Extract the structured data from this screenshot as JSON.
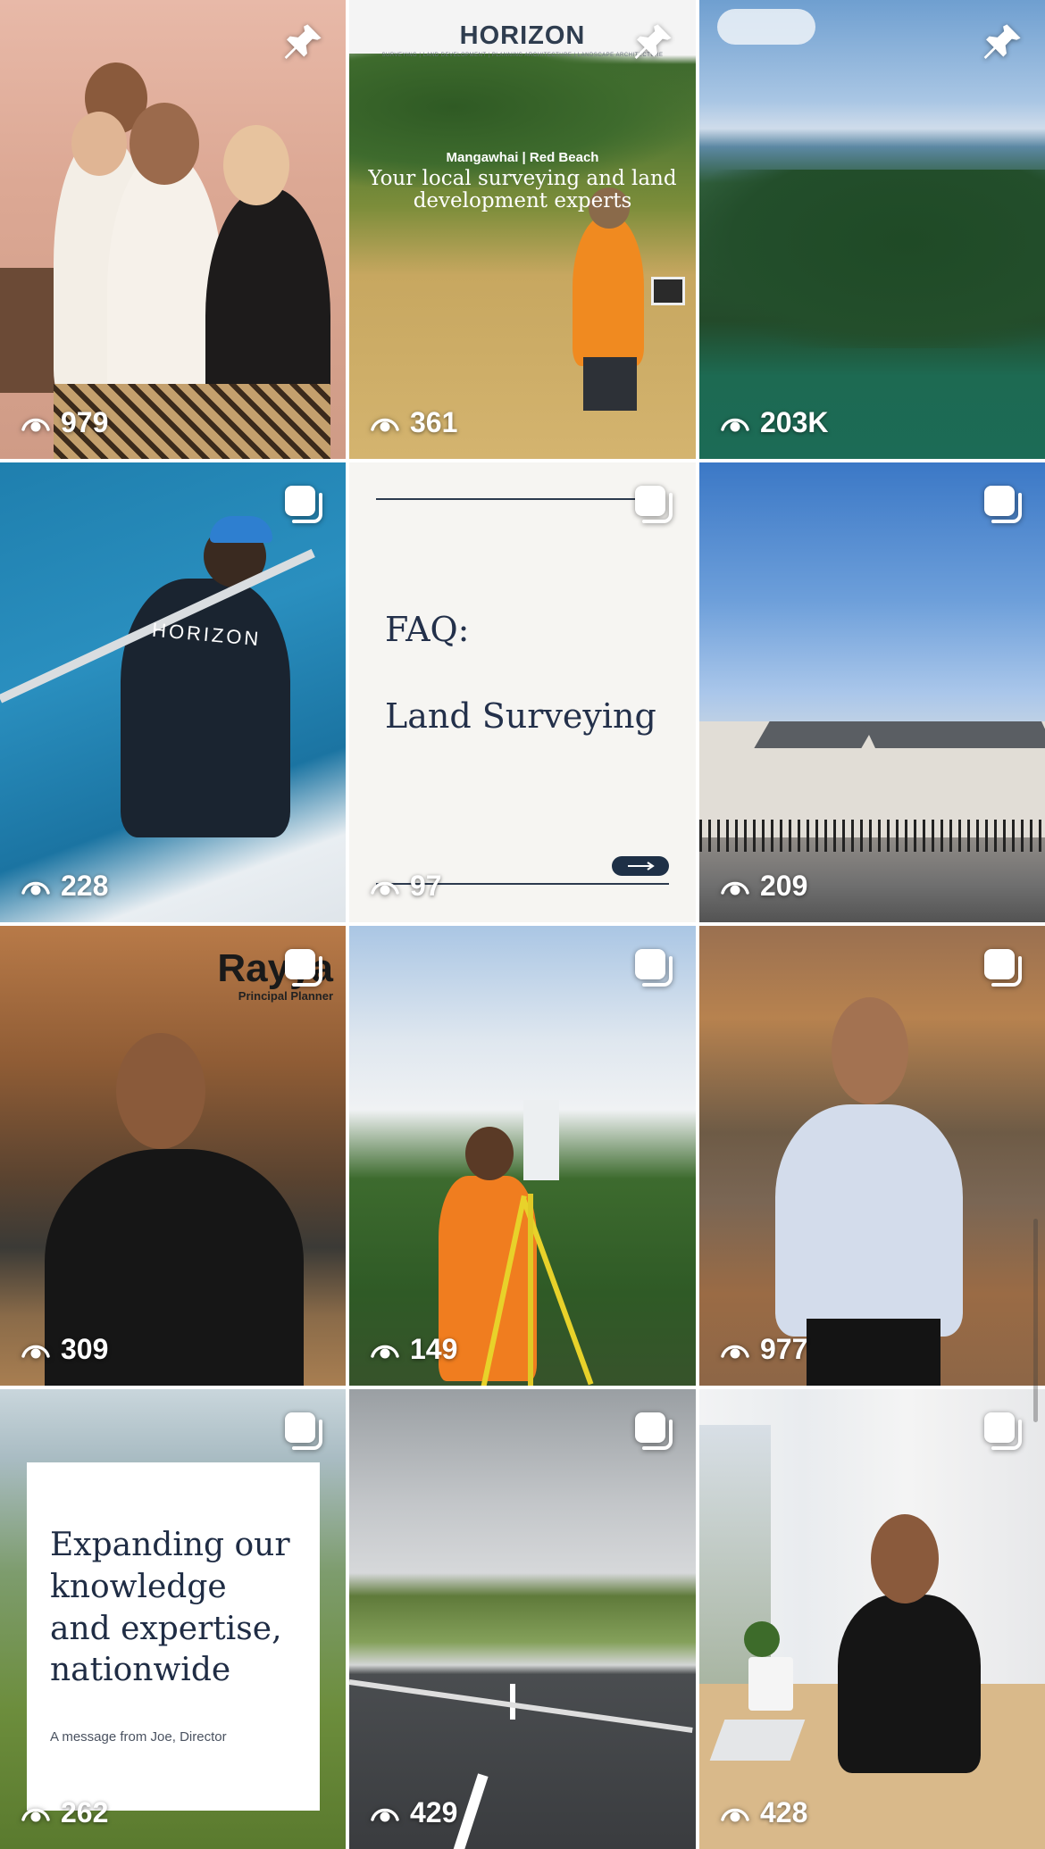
{
  "grid": {
    "tiles": [
      {
        "views": "979",
        "indicator": "pin-icon"
      },
      {
        "views": "361",
        "indicator": "pin-icon",
        "overlay": {
          "logo": "HORIZON",
          "logo_tagline": "SURVEYING | LAND DEVELOPMENT | PLANNING  ARCHITECTURE | LANDSCAPE ARCHITECTURE",
          "location": "Mangawhai | Red Beach",
          "headline": "Your local surveying and land development experts"
        }
      },
      {
        "views": "203K",
        "indicator": "pin-icon"
      },
      {
        "views": "228",
        "indicator": "carousel-icon",
        "overlay": {
          "shirt_text": "HORIZON"
        }
      },
      {
        "views": "97",
        "indicator": "carousel-icon",
        "overlay": {
          "line1": "FAQ:",
          "line2": "Land Surveying"
        }
      },
      {
        "views": "209",
        "indicator": "carousel-icon"
      },
      {
        "views": "309",
        "indicator": "carousel-icon",
        "overlay": {
          "name": "Rayya",
          "role": "Principal Planner"
        }
      },
      {
        "views": "149",
        "indicator": "carousel-icon"
      },
      {
        "views": "977",
        "indicator": "carousel-icon"
      },
      {
        "views": "262",
        "indicator": "carousel-icon",
        "overlay": {
          "headline": "Expanding our knowledge and expertise, nationwide",
          "sub": "A message from Joe, Director"
        }
      },
      {
        "views": "429",
        "indicator": "carousel-icon"
      },
      {
        "views": "428",
        "indicator": "carousel-icon"
      }
    ]
  },
  "colors": {
    "view_text": "#ffffff",
    "brand_navy": "#1f2c44",
    "card_bg": "#f6f5f2"
  }
}
